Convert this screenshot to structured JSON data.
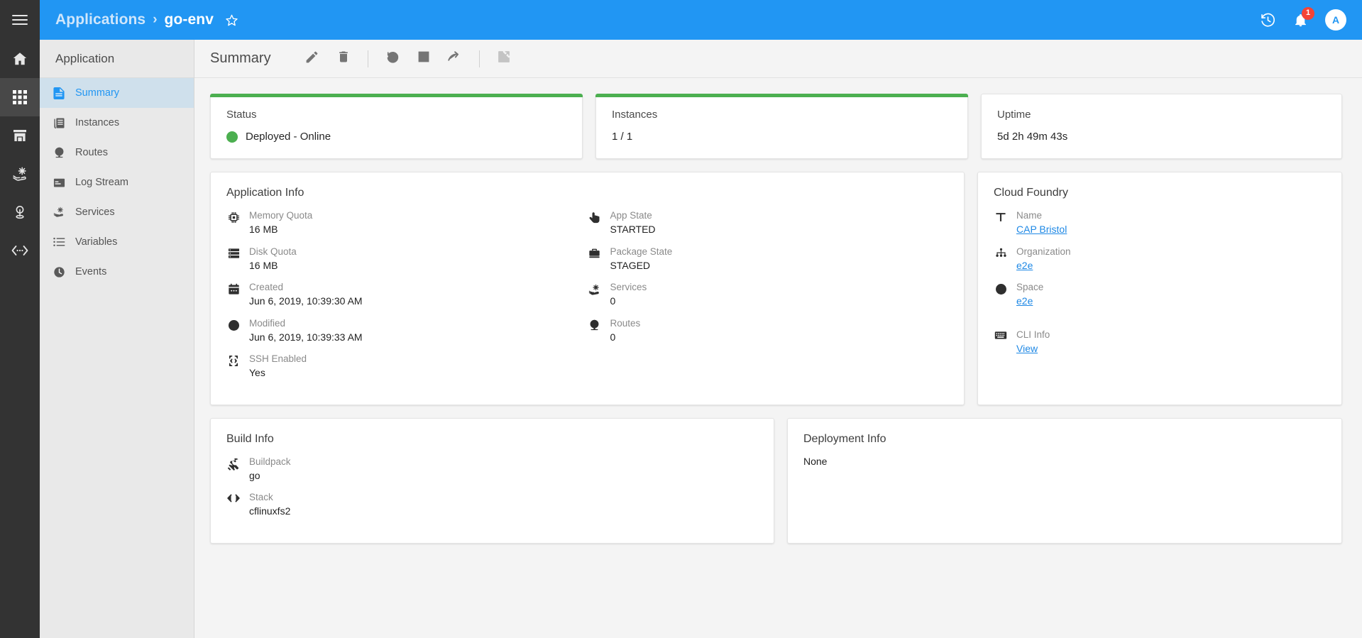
{
  "header": {
    "breadcrumb_root": "Applications",
    "breadcrumb_separator": "›",
    "breadcrumb_current": "go-env",
    "favorite_icon": "star-outline-icon",
    "menu_icon": "hamburger-menu-icon",
    "history_icon": "history-clock-icon",
    "notifications_icon": "bell-icon",
    "notifications_count": "1",
    "avatar_initial": "A",
    "brand_color": "#2196f3"
  },
  "rail": {
    "items": [
      {
        "name": "home",
        "icon": "home-icon",
        "active": false
      },
      {
        "name": "applications",
        "icon": "grid-apps-icon",
        "active": true
      },
      {
        "name": "marketplace",
        "icon": "store-icon",
        "active": false
      },
      {
        "name": "services",
        "icon": "hand-gear-icon",
        "active": false
      },
      {
        "name": "endpoints",
        "icon": "endpoint-pin-icon",
        "active": false
      },
      {
        "name": "api",
        "icon": "code-brackets-icon",
        "active": false
      }
    ]
  },
  "sidebar": {
    "title": "Application",
    "items": [
      {
        "label": "Summary",
        "icon": "document-icon",
        "active": true
      },
      {
        "label": "Instances",
        "icon": "instances-icon",
        "active": false
      },
      {
        "label": "Routes",
        "icon": "globe-route-icon",
        "active": false
      },
      {
        "label": "Log Stream",
        "icon": "log-window-icon",
        "active": false
      },
      {
        "label": "Services",
        "icon": "hand-gear-icon",
        "active": false
      },
      {
        "label": "Variables",
        "icon": "list-icon",
        "active": false
      },
      {
        "label": "Events",
        "icon": "clock-icon",
        "active": false
      }
    ]
  },
  "toolbar": {
    "title": "Summary",
    "actions": [
      {
        "name": "edit",
        "icon": "pencil-icon",
        "disabled": false
      },
      {
        "name": "delete",
        "icon": "trash-icon",
        "disabled": false
      },
      {
        "name": "restart",
        "icon": "restart-icon",
        "disabled": false
      },
      {
        "name": "stop",
        "icon": "stop-square-icon",
        "disabled": false
      },
      {
        "name": "restage",
        "icon": "redo-arrow-icon",
        "disabled": false
      },
      {
        "name": "open",
        "icon": "external-link-icon",
        "disabled": true
      }
    ]
  },
  "stats": {
    "status": {
      "label": "Status",
      "value": "Deployed - Online",
      "indicator_color": "#4caf50",
      "accent": "#4caf50"
    },
    "instances": {
      "label": "Instances",
      "value": "1 / 1",
      "accent": "#4caf50"
    },
    "uptime": {
      "label": "Uptime",
      "value": "5d 2h 49m 43s"
    }
  },
  "application_info": {
    "title": "Application Info",
    "column_left": [
      {
        "icon": "memory-chip-icon",
        "key": "Memory Quota",
        "value": "16 MB"
      },
      {
        "icon": "disk-stack-icon",
        "key": "Disk Quota",
        "value": "16 MB"
      },
      {
        "icon": "calendar-icon",
        "key": "Created",
        "value": "Jun 6, 2019, 10:39:30 AM"
      },
      {
        "icon": "clock-icon",
        "key": "Modified",
        "value": "Jun 6, 2019, 10:39:33 AM"
      },
      {
        "icon": "ssh-terminal-icon",
        "key": "SSH Enabled",
        "value": "Yes"
      }
    ],
    "column_right": [
      {
        "icon": "pointer-hand-icon",
        "key": "App State",
        "value": "STARTED"
      },
      {
        "icon": "package-icon",
        "key": "Package State",
        "value": "STAGED"
      },
      {
        "icon": "hand-gear-icon",
        "key": "Services",
        "value": "0"
      },
      {
        "icon": "globe-route-icon",
        "key": "Routes",
        "value": "0"
      }
    ]
  },
  "cloud_foundry": {
    "title": "Cloud Foundry",
    "rows": [
      {
        "icon": "text-t-icon",
        "key": "Name",
        "value": "CAP Bristol",
        "link": true
      },
      {
        "icon": "org-tree-icon",
        "key": "Organization",
        "value": "e2e",
        "link": true
      },
      {
        "icon": "globe-icon",
        "key": "Space",
        "value": "e2e",
        "link": true
      },
      {
        "icon": "keyboard-icon",
        "key": "CLI Info",
        "value": "View",
        "link": true
      }
    ]
  },
  "build_info": {
    "title": "Build Info",
    "rows": [
      {
        "icon": "wrench-icon",
        "key": "Buildpack",
        "value": "go"
      },
      {
        "icon": "code-brackets-icon",
        "key": "Stack",
        "value": "cflinuxfs2"
      }
    ]
  },
  "deployment_info": {
    "title": "Deployment Info",
    "value": "None"
  }
}
